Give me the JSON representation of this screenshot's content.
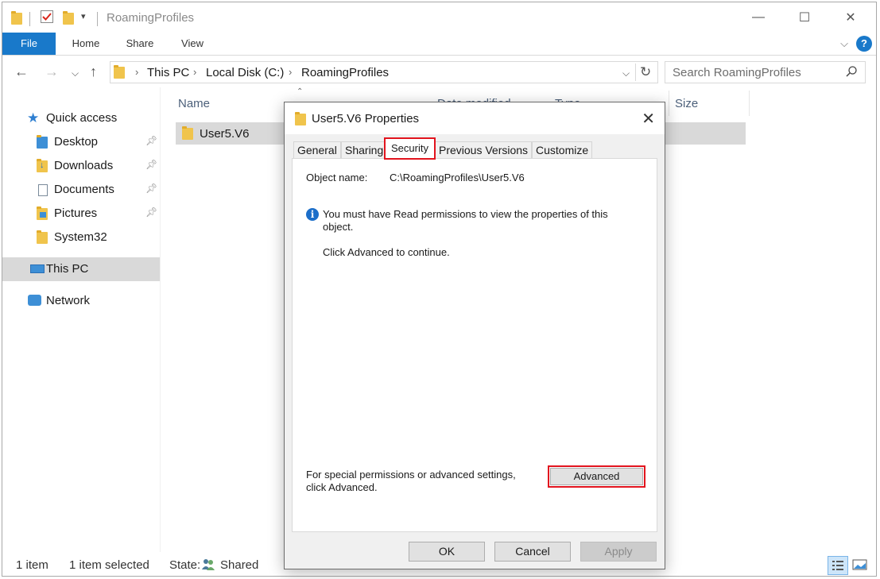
{
  "window": {
    "title": "RoamingProfiles",
    "controls": {
      "minimize": "—",
      "maximize": "☐",
      "close": "✕"
    }
  },
  "ribbon": {
    "tabs": [
      "File",
      "Home",
      "Share",
      "View"
    ],
    "help": "?"
  },
  "address": {
    "crumbs": [
      "This PC",
      "Local Disk (C:)",
      "RoamingProfiles"
    ],
    "search_placeholder": "Search RoamingProfiles"
  },
  "nav": {
    "quick_access": "Quick access",
    "items": [
      "Desktop",
      "Downloads",
      "Documents",
      "Pictures",
      "System32"
    ],
    "this_pc": "This PC",
    "network": "Network"
  },
  "file_list": {
    "columns": [
      "Name",
      "Date modified",
      "Type",
      "Size"
    ],
    "rows": [
      {
        "name": "User5.V6"
      }
    ]
  },
  "status": {
    "count": "1 item",
    "selected": "1 item selected",
    "state_label": "State:",
    "state_value": "Shared"
  },
  "dialog": {
    "title": "User5.V6 Properties",
    "tabs": [
      "General",
      "Sharing",
      "Security",
      "Previous Versions",
      "Customize"
    ],
    "active_tab": "Security",
    "object_name_label": "Object name:",
    "object_name_value": "C:\\RoamingProfiles\\User5.V6",
    "message_line1": "You must have Read permissions to view the properties of this",
    "message_line2": "object.",
    "continue_text": "Click Advanced to continue.",
    "advanced_hint_line1": "For special permissions or advanced settings,",
    "advanced_hint_line2": "click Advanced.",
    "advanced_button": "Advanced",
    "ok_button": "OK",
    "cancel_button": "Cancel",
    "apply_button": "Apply"
  },
  "colors": {
    "accent": "#1979ca",
    "highlight": "#e2141e",
    "folder": "#f0c44c"
  }
}
